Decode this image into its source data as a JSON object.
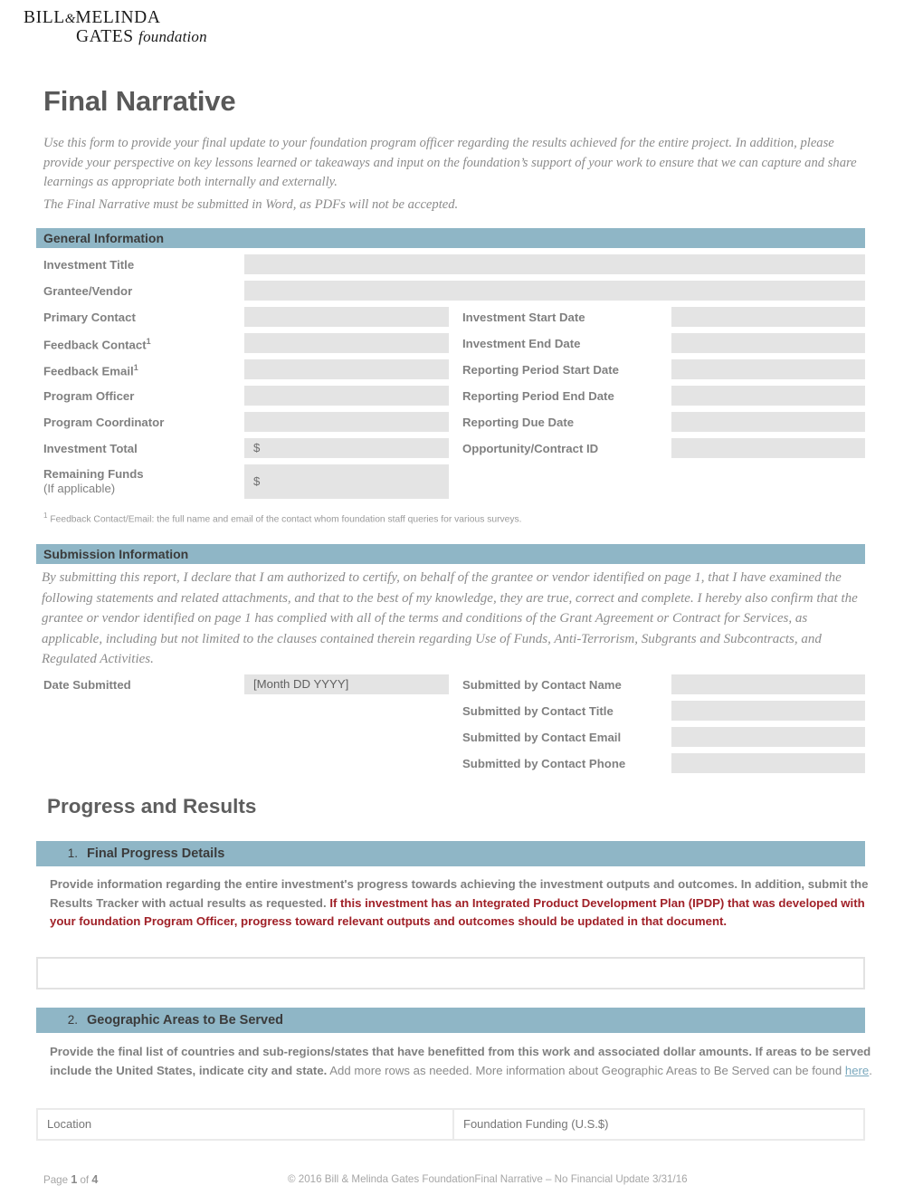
{
  "logo": {
    "line1_a": "Bill",
    "line1_amp": "&",
    "line1_b": "Melinda",
    "line2_a": "Gates",
    "line2_b": "foundation"
  },
  "document": {
    "title": "Final Narrative",
    "intro_paragraph": "Use this form to provide your final update to your foundation program officer regarding the results achieved for the entire project. In addition, please provide your perspective on key lessons learned or takeaways and input on the foundation’s support of your work to ensure that we can capture and share learnings as appropriate both internally and externally.",
    "intro_paragraph_2": "The Final Narrative must be submitted in Word, as PDFs will not be accepted."
  },
  "general_information": {
    "section_title": "General Information",
    "fields": [
      {
        "label": "Investment Title",
        "value": ""
      },
      {
        "label": "Grantee/Vendor",
        "value": ""
      },
      {
        "label": "Primary Contact",
        "value": ""
      },
      {
        "label": "Feedback Contact",
        "footnote_marker": "1",
        "value": ""
      },
      {
        "label": "Feedback Email",
        "footnote_marker": "1",
        "value": ""
      },
      {
        "label": "Program Officer",
        "value": ""
      },
      {
        "label": "Program Coordinator",
        "value": ""
      },
      {
        "label": "Investment Total",
        "prefix": "$",
        "value": ""
      },
      {
        "label": "Remaining Funds",
        "sublabel": "(If applicable)",
        "prefix": "$",
        "value": ""
      }
    ],
    "right_fields": [
      {
        "label": "Investment Start Date",
        "value": ""
      },
      {
        "label": "Investment End Date",
        "value": ""
      },
      {
        "label": "Reporting Period Start Date",
        "value": ""
      },
      {
        "label": "Reporting Period End Date",
        "value": ""
      },
      {
        "label": "Reporting Due Date",
        "value": ""
      },
      {
        "label": "Opportunity/Contract ID",
        "value": ""
      }
    ],
    "footnote_marker": "1",
    "footnote_text": "Feedback Contact/Email: the full name and email of the contact whom foundation staff queries for various surveys."
  },
  "submission_information": {
    "section_title": "Submission Information",
    "declaration": "By submitting this report, I declare that I am authorized to certify, on behalf of the grantee or vendor identified on page 1, that I have examined the following statements and related attachments, and that to the best of my knowledge, they are true, correct and complete.  I hereby also confirm that the grantee or vendor identified on page 1 has complied with all of the terms and conditions of the Grant Agreement or Contract for Services, as applicable, including but not limited to the clauses contained therein regarding Use of Funds, Anti-Terrorism, Subgrants and Subcontracts, and Regulated Activities.",
    "date_submitted_label": "Date Submitted",
    "date_submitted_value": "[Month DD YYYY]",
    "contact_fields": [
      {
        "label": "Submitted by Contact Name",
        "value": ""
      },
      {
        "label": "Submitted by Contact Title",
        "value": ""
      },
      {
        "label": "Submitted by Contact Email",
        "value": ""
      },
      {
        "label": "Submitted by Contact Phone",
        "value": ""
      }
    ]
  },
  "progress_and_results": {
    "heading": "Progress and Results",
    "section1": {
      "number": "1.",
      "title": "Final Progress Details",
      "instruction_plain": "Provide information regarding the entire investment's progress towards achieving the investment outputs and outcomes. In addition, submit the Results Tracker with actual results as requested. ",
      "instruction_red": "If this investment has an Integrated Product Development Plan (IPDP) that was developed with your foundation Program Officer, progress toward relevant outputs and outcomes should be updated in that document.",
      "answer_value": ""
    },
    "section2": {
      "number": "2.",
      "title": "Geographic Areas to Be Served",
      "instruction_bold": "Provide the final list of countries and sub-regions/states that have benefitted from this work and associated dollar amounts. If areas to be served include the United States, indicate city and state.",
      "instruction_plain": " Add more rows as needed. More information about Geographic Areas to Be Served can be found ",
      "link_text": "here",
      "instruction_end": ".",
      "table": {
        "columns": [
          "Location",
          "Foundation Funding (U.S.$)"
        ],
        "rows": []
      }
    }
  },
  "footer": {
    "page_prefix": "Page ",
    "page_number": "1",
    "page_middle": " of ",
    "page_total": "4",
    "copyright": "© 2016 Bill & Melinda Gates Foundation",
    "doc_ref": "Final Narrative – No Financial Update 3/31/16"
  },
  "colors": {
    "section_bar": "#8fb6c6",
    "field_fill": "#e4e4e4",
    "title_text": "#595959",
    "body_text": "#8b8b8b",
    "alert_red": "#a02128",
    "link_blue": "#7aa8bd"
  }
}
